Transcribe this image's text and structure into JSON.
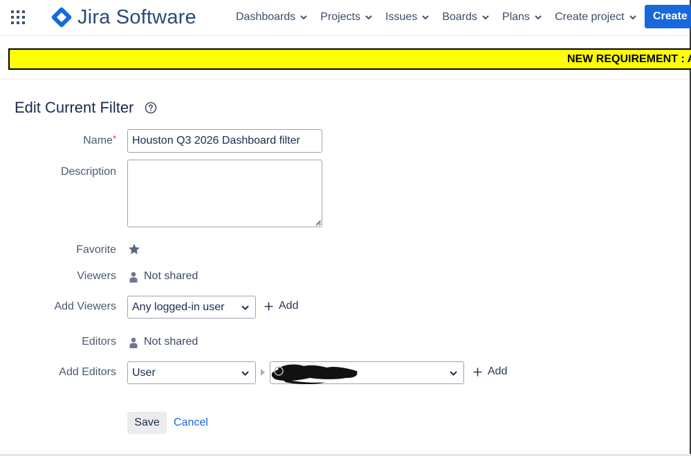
{
  "header": {
    "product_name": "Jira Software",
    "nav": [
      {
        "label": "Dashboards"
      },
      {
        "label": "Projects"
      },
      {
        "label": "Issues"
      },
      {
        "label": "Boards"
      },
      {
        "label": "Plans"
      },
      {
        "label": "Create project"
      }
    ],
    "create_label": "Create"
  },
  "banner": {
    "text": "NEW REQUIREMENT : A"
  },
  "page": {
    "title": "Edit Current Filter"
  },
  "form": {
    "name_label": "Name",
    "required_marker": "*",
    "name_value": "Houston Q3 2026 Dashboard filter",
    "description_label": "Description",
    "description_value": "",
    "favorite_label": "Favorite",
    "viewers_label": "Viewers",
    "viewers_value": "Not shared",
    "add_viewers_label": "Add Viewers",
    "add_viewers_selected": "Any logged-in user",
    "add_label": "Add",
    "editors_label": "Editors",
    "editors_value": "Not shared",
    "add_editors_label": "Add Editors",
    "add_editors_selected": "User",
    "save_label": "Save",
    "cancel_label": "Cancel"
  },
  "colors": {
    "brand_blue": "#1868db",
    "banner_yellow": "#ffff00",
    "required_red": "#de350b"
  },
  "icons": [
    "app-switcher-icon",
    "jira-logo-icon",
    "chevron-down-icon",
    "help-icon",
    "star-icon",
    "person-icon",
    "plus-icon",
    "caret-right-icon"
  ]
}
